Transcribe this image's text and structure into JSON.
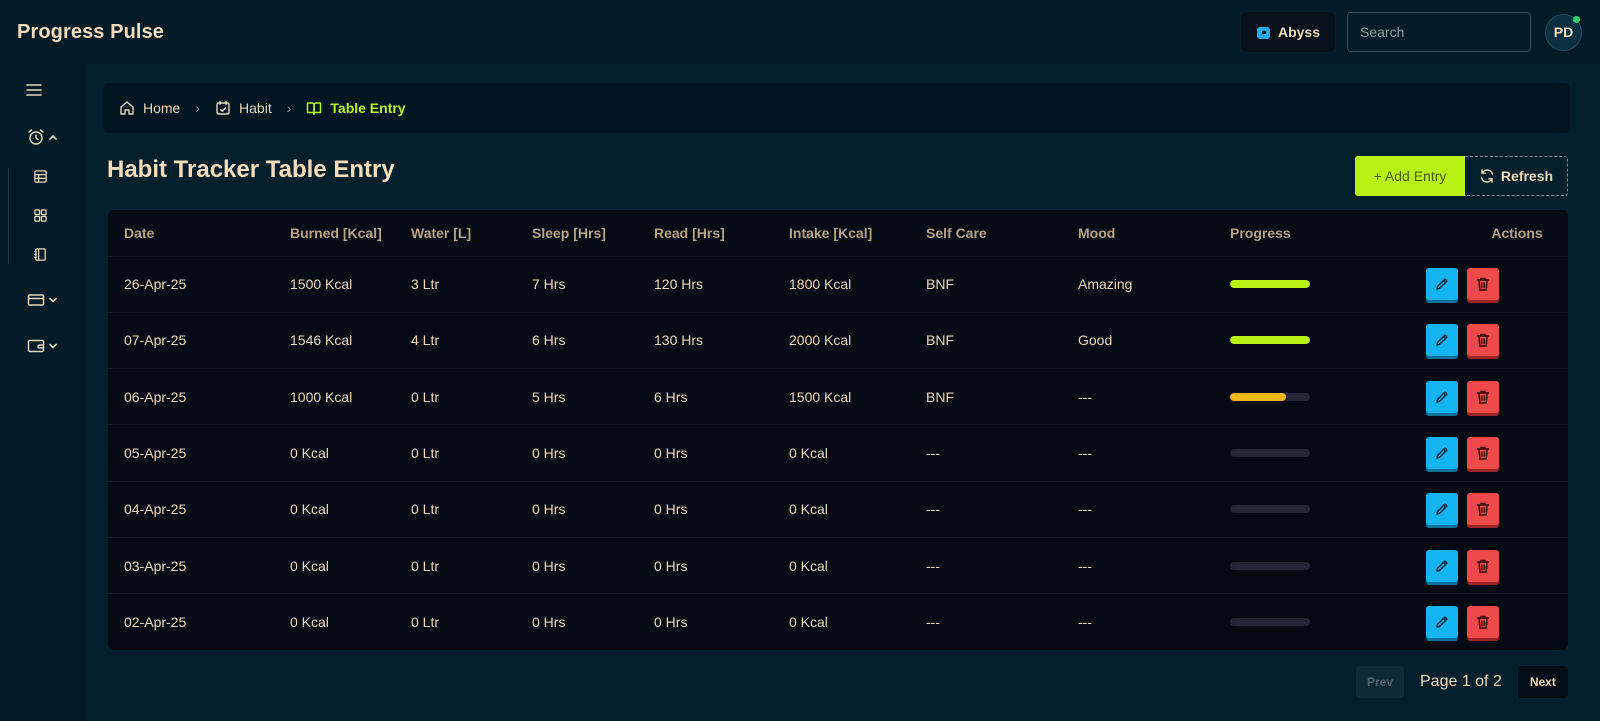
{
  "app": {
    "title": "Progress Pulse"
  },
  "header": {
    "theme_label": "Abyss",
    "search_placeholder": "Search",
    "avatar_initials": "PD"
  },
  "breadcrumb": {
    "home": "Home",
    "habit": "Habit",
    "current": "Table Entry"
  },
  "page": {
    "title": "Habit Tracker Table Entry",
    "add_label": "+ Add Entry",
    "refresh_label": "Refresh"
  },
  "table": {
    "headers": [
      "Date",
      "Burned [Kcal]",
      "Water [L]",
      "Sleep [Hrs]",
      "Read [Hrs]",
      "Intake [Kcal]",
      "Self Care",
      "Mood",
      "Progress",
      "Actions"
    ],
    "rows": [
      {
        "date": "26-Apr-25",
        "burned": "1500 Kcal",
        "water": "3 Ltr",
        "sleep": "7 Hrs",
        "read": "120 Hrs",
        "intake": "1800 Kcal",
        "selfcare": "BNF",
        "mood": "Amazing",
        "progress": 1.0,
        "progress_color": "#b8f215"
      },
      {
        "date": "07-Apr-25",
        "burned": "1546 Kcal",
        "water": "4 Ltr",
        "sleep": "6 Hrs",
        "read": "130 Hrs",
        "intake": "2000 Kcal",
        "selfcare": "BNF",
        "mood": "Good",
        "progress": 1.0,
        "progress_color": "#b8f215"
      },
      {
        "date": "06-Apr-25",
        "burned": "1000 Kcal",
        "water": "0 Ltr",
        "sleep": "5 Hrs",
        "read": "6 Hrs",
        "intake": "1500 Kcal",
        "selfcare": "BNF",
        "mood": "---",
        "progress": 0.7,
        "progress_color": "#f5b818"
      },
      {
        "date": "05-Apr-25",
        "burned": "0 Kcal",
        "water": "0 Ltr",
        "sleep": "0 Hrs",
        "read": "0 Hrs",
        "intake": "0 Kcal",
        "selfcare": "---",
        "mood": "---",
        "progress": 0,
        "progress_color": "#1f2834"
      },
      {
        "date": "04-Apr-25",
        "burned": "0 Kcal",
        "water": "0 Ltr",
        "sleep": "0 Hrs",
        "read": "0 Hrs",
        "intake": "0 Kcal",
        "selfcare": "---",
        "mood": "---",
        "progress": 0,
        "progress_color": "#1f2834"
      },
      {
        "date": "03-Apr-25",
        "burned": "0 Kcal",
        "water": "0 Ltr",
        "sleep": "0 Hrs",
        "read": "0 Hrs",
        "intake": "0 Kcal",
        "selfcare": "---",
        "mood": "---",
        "progress": 0,
        "progress_color": "#1f2834"
      },
      {
        "date": "02-Apr-25",
        "burned": "0 Kcal",
        "water": "0 Ltr",
        "sleep": "0 Hrs",
        "read": "0 Hrs",
        "intake": "0 Kcal",
        "selfcare": "---",
        "mood": "---",
        "progress": 0,
        "progress_color": "#1f2834"
      }
    ]
  },
  "pagination": {
    "prev_label": "Prev",
    "page_info": "Page 1 of 2",
    "next_label": "Next"
  },
  "sidebar": {
    "icons": [
      "menu-icon",
      "alarm-clock-icon",
      "table-icon",
      "grid-icon",
      "notebook-icon",
      "credit-card-icon",
      "wallet-icon"
    ]
  },
  "colors": {
    "accent": "#b8f215",
    "edit": "#14b4f0",
    "delete": "#ee4a4a",
    "background": "#01202b"
  }
}
